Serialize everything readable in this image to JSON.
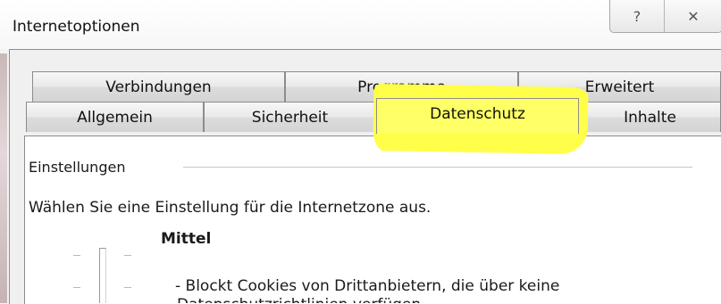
{
  "window": {
    "title": "Internetoptionen",
    "help_glyph": "?",
    "close_glyph": "✕"
  },
  "tabs": {
    "row1": [
      "Verbindungen",
      "Programme",
      "Erweitert"
    ],
    "row2": [
      "Allgemein",
      "Sicherheit",
      "Datenschutz",
      "Inhalte"
    ],
    "active": "Datenschutz",
    "highlight_color": "#ffff4a"
  },
  "settings": {
    "group_label": "Einstellungen",
    "intro_text": "Wählen Sie eine Einstellung für die Internetzone aus.",
    "level_name": "Mittel",
    "description_line1": "- Blockt Cookies von Drittanbietern, die über keine",
    "description_line2": "Datenschutzrichtlinien verfügen"
  }
}
